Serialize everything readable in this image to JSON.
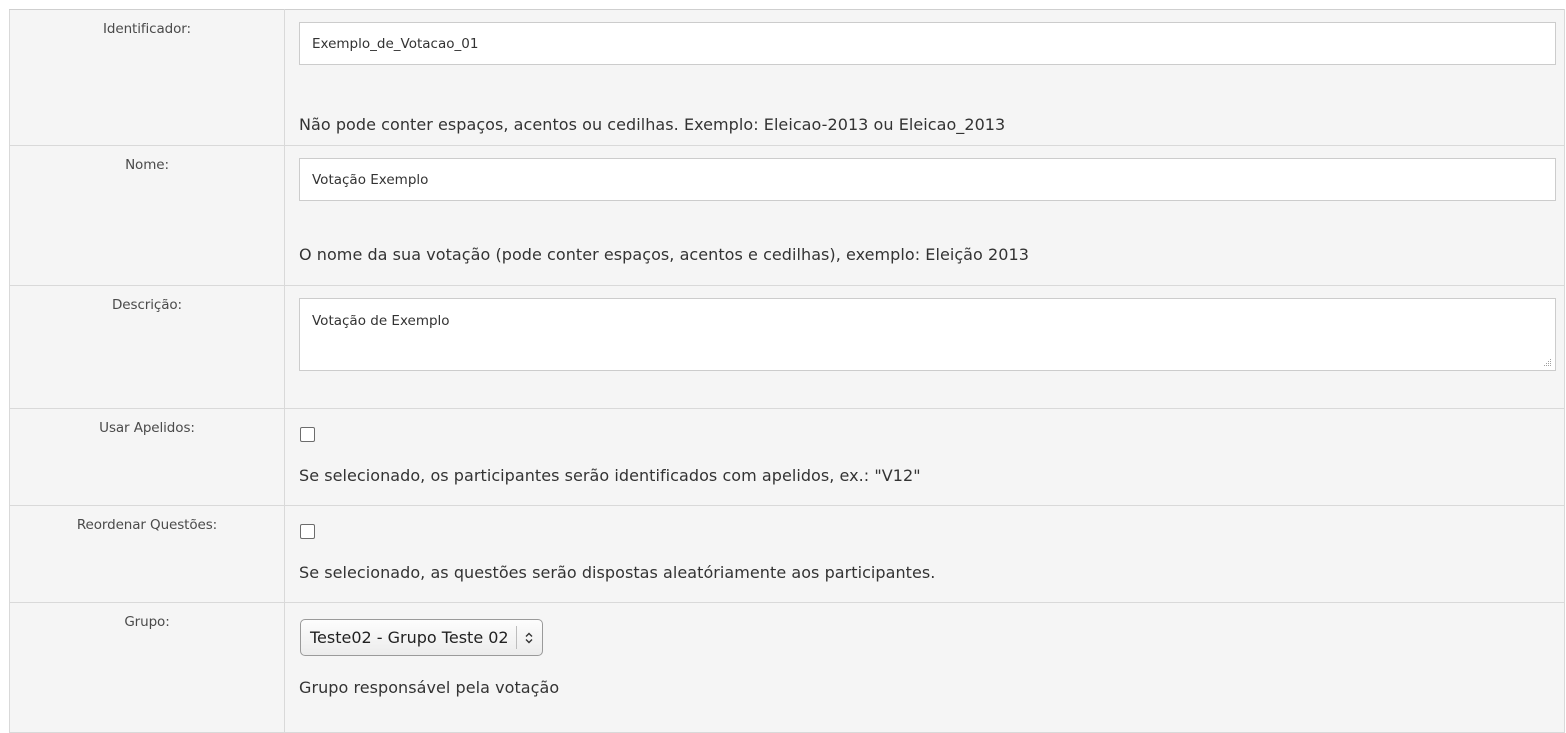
{
  "form": {
    "identifier": {
      "label": "Identificador:",
      "value": "Exemplo_de_Votacao_01",
      "help": "Não pode conter espaços, acentos ou cedilhas. Exemplo: Eleicao-2013 ou Eleicao_2013"
    },
    "name": {
      "label": "Nome:",
      "value": "Votação Exemplo",
      "help": "O nome da sua votação (pode conter espaços, acentos e cedilhas), exemplo: Eleição 2013"
    },
    "description": {
      "label": "Descrição:",
      "value": "Votação de Exemplo"
    },
    "use_nicknames": {
      "label": "Usar Apelidos:",
      "checked": false,
      "help": "Se selecionado, os participantes serão identificados com apelidos, ex.: \"V12\""
    },
    "reorder_questions": {
      "label": "Reordenar Questões:",
      "checked": false,
      "help": "Se selecionado, as questões serão dispostas aleatóriamente aos participantes."
    },
    "group": {
      "label": "Grupo:",
      "selected": "Teste02 - Grupo Teste 02",
      "help": "Grupo responsável pela votação",
      "arrow_icon": "updown-chevron-icon"
    }
  }
}
